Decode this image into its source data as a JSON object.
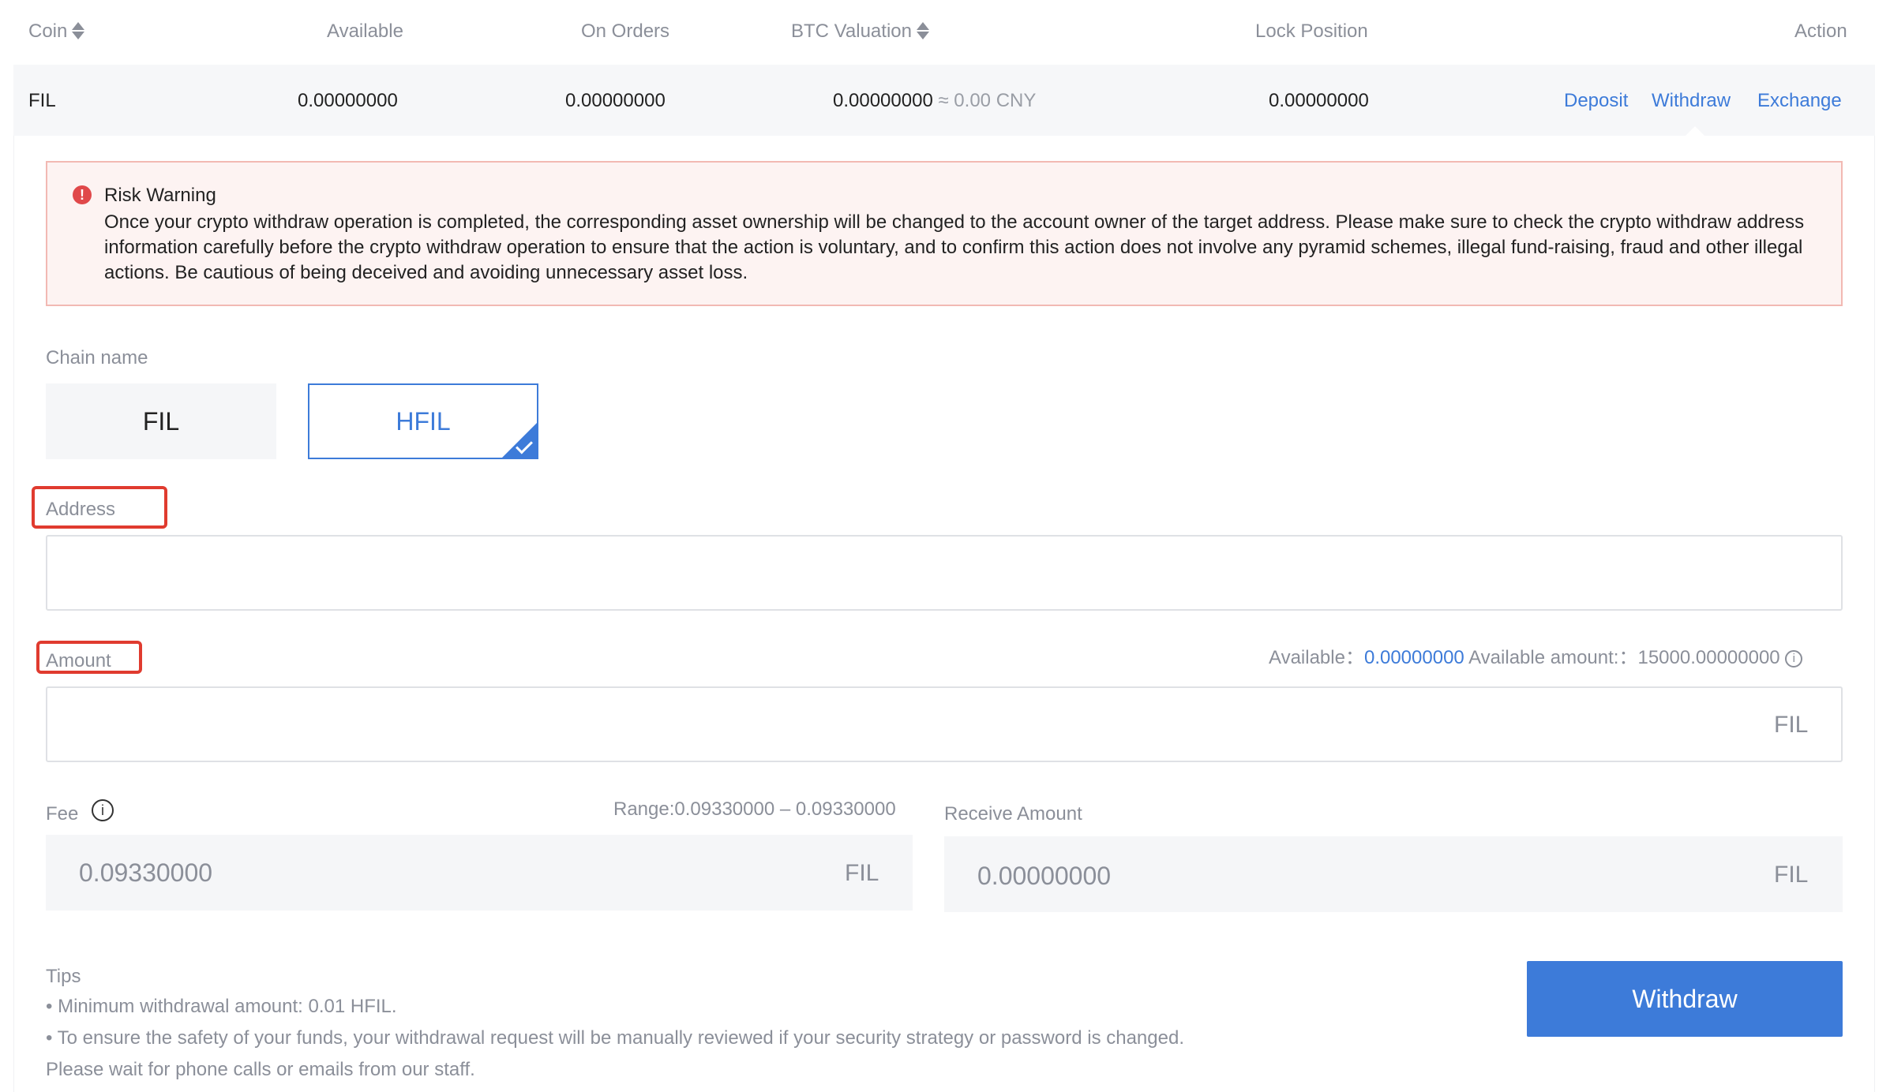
{
  "table": {
    "headers": {
      "coin": "Coin",
      "available": "Available",
      "on_orders": "On Orders",
      "btc_valuation": "BTC Valuation",
      "lock_position": "Lock Position",
      "action": "Action"
    },
    "row": {
      "coin": "FIL",
      "available": "0.00000000",
      "on_orders": "0.00000000",
      "btc_valuation": "0.00000000",
      "cny_valuation": "≈ 0.00 CNY",
      "lock_position": "0.00000000",
      "actions": {
        "deposit": "Deposit",
        "withdraw": "Withdraw",
        "exchange": "Exchange"
      }
    }
  },
  "risk_warning": {
    "icon": "exclamation-icon",
    "title": "Risk Warning",
    "text": "Once your crypto withdraw operation is completed, the corresponding asset ownership will be changed to the account owner of the target address. Please make sure to check the crypto withdraw address information carefully before the crypto withdraw operation to ensure that the action is voluntary, and to confirm this action does not involve any pyramid schemes, illegal fund-raising, fraud and other illegal actions. Be cautious of being deceived and avoiding unnecessary asset loss."
  },
  "chain": {
    "label": "Chain name",
    "options": [
      "FIL",
      "HFIL"
    ],
    "selected": "HFIL"
  },
  "address": {
    "label": "Address",
    "value": ""
  },
  "amount": {
    "label": "Amount",
    "available_label": "Available：",
    "available_value": "0.00000000",
    "available_amount_label": "Available amount:：",
    "available_amount_value": "15000.00000000",
    "value": "",
    "unit": "FIL"
  },
  "fee": {
    "label": "Fee",
    "range": "Range:0.09330000 – 0.09330000",
    "value": "0.09330000",
    "unit": "FIL"
  },
  "receive": {
    "label": "Receive Amount",
    "value": "0.00000000",
    "unit": "FIL"
  },
  "tips": {
    "title": "Tips",
    "lines": [
      "• Minimum withdrawal amount: 0.01 HFIL.",
      "• To ensure the safety of your funds, your withdrawal request will be manually reviewed if your security strategy or password is changed. Please wait for phone calls or emails from our staff."
    ]
  },
  "withdraw_button": "Withdraw",
  "colors": {
    "accent": "#3d7bd9",
    "warning_bg": "#fdf3f2",
    "warning_border": "#f2b9b3",
    "highlight_box": "#e03b2f"
  }
}
